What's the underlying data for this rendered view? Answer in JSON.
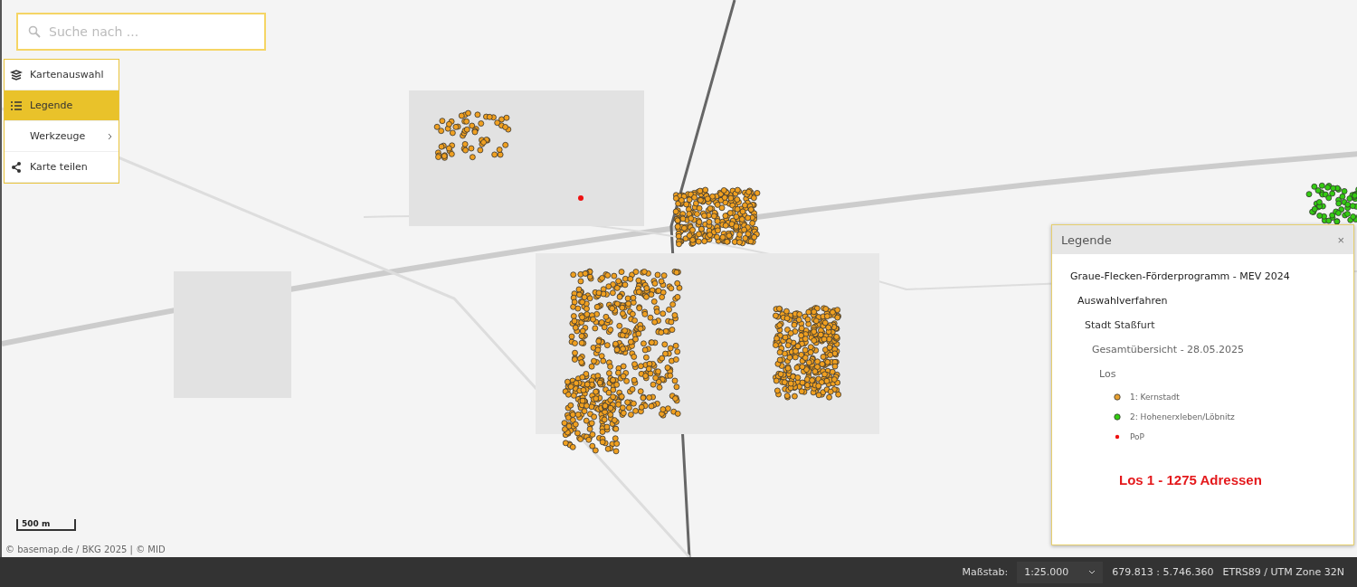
{
  "search": {
    "placeholder": "Suche nach ..."
  },
  "menu": [
    {
      "label": "Kartenauswahl",
      "kind": "layers",
      "selected": false,
      "submenu": false
    },
    {
      "label": "Legende",
      "kind": "list",
      "selected": true,
      "submenu": false
    },
    {
      "label": "Werkzeuge",
      "kind": "plain",
      "selected": false,
      "submenu": true
    },
    {
      "label": "Karte teilen",
      "kind": "share",
      "selected": false,
      "submenu": false
    }
  ],
  "map": {
    "scale_bar": "500 m",
    "attribution": "© basemap.de / BKG 2025 | © MID"
  },
  "legend": {
    "title": "Legende",
    "close": "×",
    "tree": [
      {
        "label": "Graue-Flecken-Förderprogramm - MEV 2024",
        "children": [
          {
            "label": "Auswahlverfahren",
            "children": [
              {
                "label": "Stadt Staßfurt",
                "children": [
                  {
                    "label": "Gesamtübersicht - 28.05.2025",
                    "children": [
                      {
                        "label": "Los",
                        "children": [
                          {
                            "label": "1: Kernstadt",
                            "kind": "circle",
                            "color": "#e8a030"
                          },
                          {
                            "label": "2: Hohenerxleben/Löbnitz",
                            "kind": "circle",
                            "color": "#33cc11"
                          },
                          {
                            "label": "PoP",
                            "kind": "dot",
                            "color": "#ee1111"
                          }
                        ]
                      }
                    ]
                  }
                ]
              }
            ]
          }
        ]
      }
    ],
    "note": "Los 1 - 1275 Adressen"
  },
  "status_bar": {
    "scale_label": "Maßstab:",
    "scale_value": "1:25.000",
    "coordinates": "679.813 : 5.746.360",
    "crs": "ETRS89 / UTM Zone 32N"
  }
}
